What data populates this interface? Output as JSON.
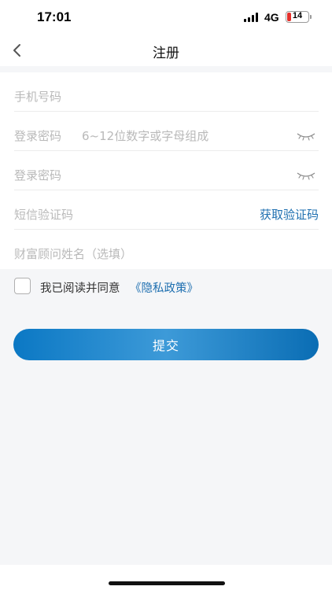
{
  "status_bar": {
    "time": "17:01",
    "network": "4G",
    "battery_level": "14",
    "battery_color": "#e5302b"
  },
  "nav": {
    "title": "注册",
    "back_icon": "chevron-left-icon"
  },
  "form": {
    "phone": {
      "label": "手机号码"
    },
    "password": {
      "label": "登录密码",
      "hint": "6~12位数字或字母组成",
      "icon": "eye-closed-icon"
    },
    "password_confirm": {
      "label": "登录密码",
      "icon": "eye-closed-icon"
    },
    "sms_code": {
      "label": "短信验证码",
      "button_label": "获取验证码"
    },
    "advisor": {
      "label": "财富顾问姓名（选填）"
    }
  },
  "agreement": {
    "checked": false,
    "text": "我已阅读并同意",
    "link": "《隐私政策》"
  },
  "submit": {
    "label": "提交"
  },
  "colors": {
    "accent": "#1e6fb0",
    "button_gradient_start": "#0b78c4",
    "button_gradient_end": "#0a6db4",
    "page_background": "#f5f6f8"
  }
}
